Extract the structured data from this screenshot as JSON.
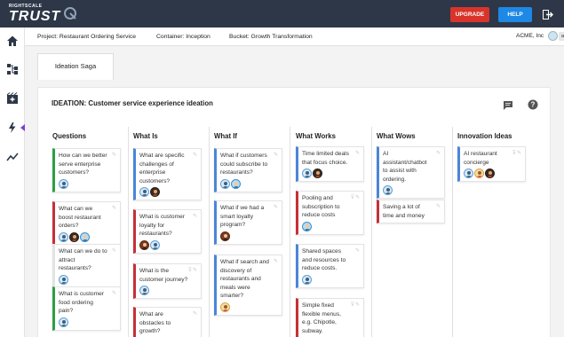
{
  "brand": {
    "small": "RIGHTSCALE",
    "big": "TRUST"
  },
  "header": {
    "upgrade_label": "UPGRADE",
    "help_label": "HELP"
  },
  "breadcrumbs": {
    "project": "Project: Restaurant Ordering Service",
    "container": "Container: Inception",
    "bucket": "Bucket: Growth Transformation",
    "account": "ACME, Inc",
    "user": "apollo"
  },
  "tab": {
    "label": "Ideation Saga"
  },
  "panel": {
    "title": "IDEATION: Customer service experience ideation"
  },
  "columns": [
    {
      "title": "Questions",
      "cards": [
        {
          "text": "How can we better serve enterprise customers?",
          "color": "green",
          "avatars": [
            "a1"
          ]
        },
        {
          "text": "What can we boost restaurant orders?",
          "color": "red",
          "avatars": [
            "a1",
            "a4",
            "a5"
          ]
        },
        {
          "text": "What can we do to attract restaurants?",
          "color": "none",
          "avatars": [
            "a1"
          ]
        },
        {
          "text": "What is customer food ordering pain?",
          "color": "green",
          "avatars": [
            "a1"
          ]
        }
      ]
    },
    {
      "title": "What Is",
      "cards": [
        {
          "text": "What are specific challenges of enterprise customers?",
          "color": "blue",
          "avatars": [
            "a1",
            "a4"
          ]
        },
        {
          "text": "What is customer loyalty for restaurants?",
          "color": "red",
          "avatars": [
            "a2",
            "a1"
          ]
        },
        {
          "text": "What is the customer journey?",
          "color": "red",
          "avatars": [
            "a1"
          ]
        },
        {
          "text": "What are obstacles to growth?",
          "color": "red",
          "avatars": []
        }
      ]
    },
    {
      "title": "What If",
      "cards": [
        {
          "text": "What if customers could subscribe to restaurants?",
          "color": "blue",
          "avatars": [
            "a1",
            "a5"
          ]
        },
        {
          "text": "What if we had a smart loyalty program?",
          "color": "blue",
          "avatars": [
            "a2"
          ]
        },
        {
          "text": "What if search and discovery of restaurants and meals were smarter?",
          "color": "blue",
          "avatars": [
            "a3"
          ]
        }
      ]
    },
    {
      "title": "What Works",
      "cards": [
        {
          "text": "Time limited deals that focus choice.",
          "color": "blue",
          "avatars": [
            "a1",
            "a4"
          ]
        },
        {
          "text": "Pooling and subscription to reduce costs",
          "color": "red",
          "avatars": [
            "a5"
          ]
        },
        {
          "text": "Shared spaces and resources to reduce costs.",
          "color": "blue",
          "avatars": [
            "a1"
          ]
        },
        {
          "text": "Simple fixed flexible menus, e.g. Chipotle, subway.",
          "color": "red",
          "avatars": []
        }
      ]
    },
    {
      "title": "What Wows",
      "cards": [
        {
          "text": "AI assistant/chatbot to assist with ordering.",
          "color": "blue",
          "avatars": [
            "a1"
          ]
        },
        {
          "text": "Saving a lot of time and money",
          "color": "red",
          "avatars": []
        }
      ]
    },
    {
      "title": "Innovation Ideas",
      "cards": [
        {
          "text": "AI restaurant concierge",
          "color": "blue",
          "avatars": [
            "a1",
            "a3",
            "a4"
          ]
        }
      ]
    }
  ]
}
